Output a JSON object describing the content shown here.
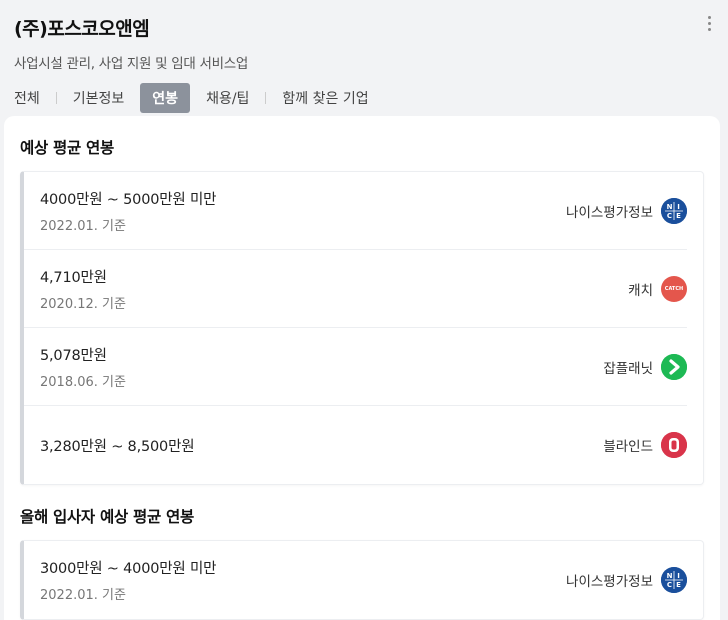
{
  "header": {
    "company": "(주)포스코오앤엠",
    "subtitle": "사업시설 관리, 사업 지원 및 임대 서비스업",
    "tabs": [
      "전체",
      "기본정보",
      "연봉",
      "채용/팁",
      "함께 찾은 기업"
    ],
    "active_tab": "연봉"
  },
  "salary": {
    "title": "예상 평균 연봉",
    "items": [
      {
        "amount": "4000만원 ~ 5000만원 미만",
        "date": "2022.01. 기준",
        "source": "나이스평가정보",
        "logo": "nice-logo-icon"
      },
      {
        "amount": "4,710만원",
        "date": "2020.12. 기준",
        "source": "캐치",
        "logo": "catch-logo-icon"
      },
      {
        "amount": "5,078만원",
        "date": "2018.06. 기준",
        "source": "잡플래닛",
        "logo": "jobplanet-logo-icon"
      },
      {
        "amount": "3,280만원 ~ 8,500만원",
        "date": "",
        "source": "블라인드",
        "logo": "blind-logo-icon"
      }
    ]
  },
  "newhire": {
    "title": "올해 입사자 예상 평균 연봉",
    "items": [
      {
        "amount": "3000만원 ~ 4000만원 미만",
        "date": "2022.01. 기준",
        "source": "나이스평가정보",
        "logo": "nice-logo-icon"
      }
    ]
  },
  "logo_text": {
    "catch": "CATCH"
  },
  "colors": {
    "active_tab_bg": "#8c929c",
    "nice": "#1a4f9c",
    "catch": "#e4564c",
    "jobplanet": "#1db954",
    "blind": "#d9344a"
  }
}
